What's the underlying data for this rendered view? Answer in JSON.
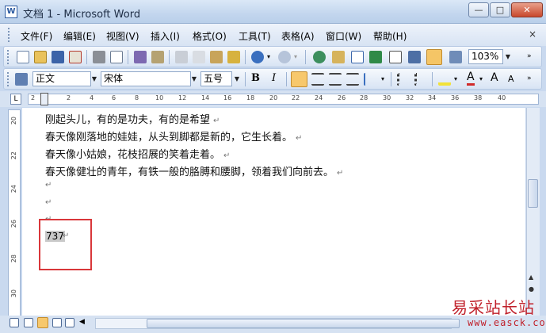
{
  "window": {
    "app_icon_letter": "W",
    "title": "文档 1 - Microsoft Word",
    "minimize": "—",
    "maximize": "□",
    "close": "✕"
  },
  "menubar": {
    "items": [
      "文件(F)",
      "编辑(E)",
      "视图(V)",
      "插入(I)",
      "格式(O)",
      "工具(T)",
      "表格(A)",
      "窗口(W)",
      "帮助(H)"
    ],
    "doc_close": "×"
  },
  "standard_toolbar": {
    "zoom": "103%",
    "icons": [
      "new-doc-icon",
      "open-folder-icon",
      "save-icon",
      "permission-icon",
      "print-icon",
      "print-preview-icon",
      "spelling-icon",
      "research-icon",
      "cut-icon",
      "copy-icon",
      "paste-icon",
      "format-painter-icon",
      "undo-icon",
      "redo-icon",
      "hyperlink-icon",
      "tables-borders-icon",
      "insert-table-icon",
      "insert-excel-icon",
      "columns-icon",
      "drawing-icon",
      "doc-map-icon",
      "show-hide-icon",
      "read-icon"
    ]
  },
  "formatting_toolbar": {
    "style": "正文",
    "font": "宋体",
    "size": "五号",
    "bold": "B",
    "italic": "I",
    "font_color_letter": "A",
    "grow_font": "A",
    "shrink_font": "A"
  },
  "ruler": {
    "ticks": [
      "2",
      "2",
      "4",
      "6",
      "8",
      "10",
      "12",
      "14",
      "16",
      "18",
      "20",
      "22",
      "24",
      "26",
      "28",
      "30",
      "32",
      "34",
      "36",
      "38",
      "40"
    ],
    "vertical_ticks": [
      "20",
      "22",
      "24",
      "26",
      "28",
      "30"
    ]
  },
  "document": {
    "lines": [
      "刚起头儿，有的是功夫，有的是希望",
      "春天像刚落地的娃娃，从头到脚都是新的，它生长着。",
      "春天像小姑娘，花枝招展的笑着走着。",
      "春天像健壮的青年，有铁一般的胳膊和腰脚，领着我们向前去。"
    ],
    "paragraph_mark": "↵",
    "selected_text": "737"
  },
  "watermark": {
    "name": "易采站长站",
    "url": "www.easck.com"
  }
}
